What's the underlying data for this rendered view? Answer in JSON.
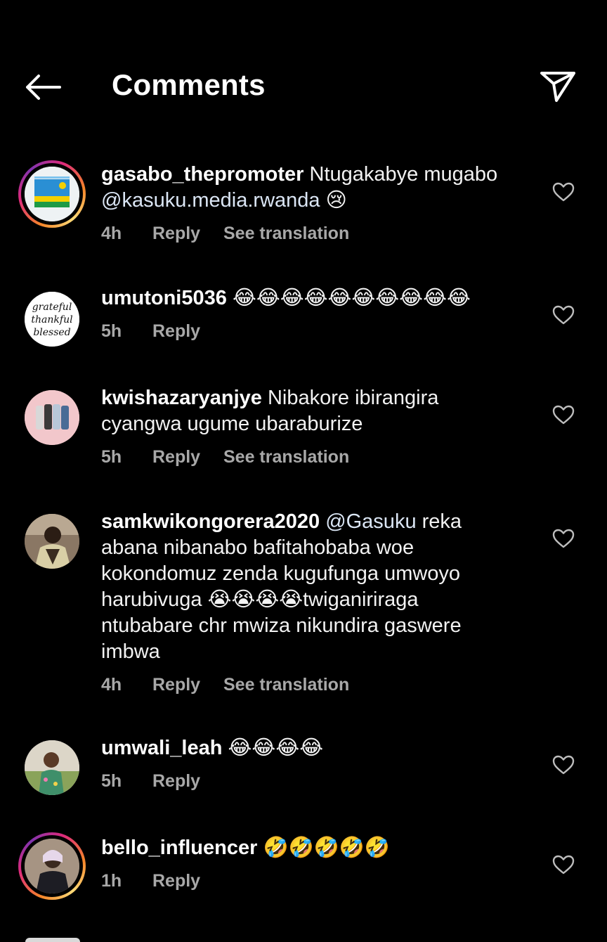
{
  "header": {
    "title": "Comments",
    "back_icon": "arrow-left-icon",
    "share_icon": "paper-plane-icon"
  },
  "actions": {
    "reply": "Reply",
    "see_translation": "See translation"
  },
  "comments": [
    {
      "username": "gasabo_thepromoter",
      "text_before": "Ntugakabye mugabo",
      "mention": "@kasuku.media.rwanda",
      "emoji": "😢",
      "time": "4h",
      "has_story_ring": true,
      "translatable": true
    },
    {
      "username": "umutoni5036",
      "emoji_count": 10,
      "emoji": "😂",
      "time": "5h",
      "avatar_text": "grateful thankful blessed",
      "translatable": false
    },
    {
      "username": "kwishazaryanjye",
      "text": "Nibakore ibirangira cyangwa ugume ubaraburize",
      "time": "5h",
      "translatable": true
    },
    {
      "username": "samkwikongorera2020",
      "mention": "@Gasuku",
      "text_line1": "reka",
      "text_line2": "abana nibanabo bafitahobaba woe",
      "text_line3": "kokondomuz zenda kugufunga umwoyo",
      "text_line4a": "harubivuga",
      "emoji": "😭",
      "emoji_count": 4,
      "text_line4b": "twiganiriraga",
      "text_line5": "ntubabare chr mwiza nikundira gaswere",
      "text_line6": "imbwa",
      "time": "4h",
      "translatable": true
    },
    {
      "username": "umwali_leah",
      "emoji": "😂",
      "emoji_count": 4,
      "time": "5h",
      "translatable": false
    },
    {
      "username": "bello_influencer",
      "emoji": "🤣",
      "emoji_count": 5,
      "time": "1h",
      "has_story_ring": true,
      "translatable": false
    }
  ],
  "colors": {
    "background": "#000000",
    "text": "#f2f2f2",
    "meta": "#a8a8a8",
    "mention": "#dbe6f5"
  }
}
